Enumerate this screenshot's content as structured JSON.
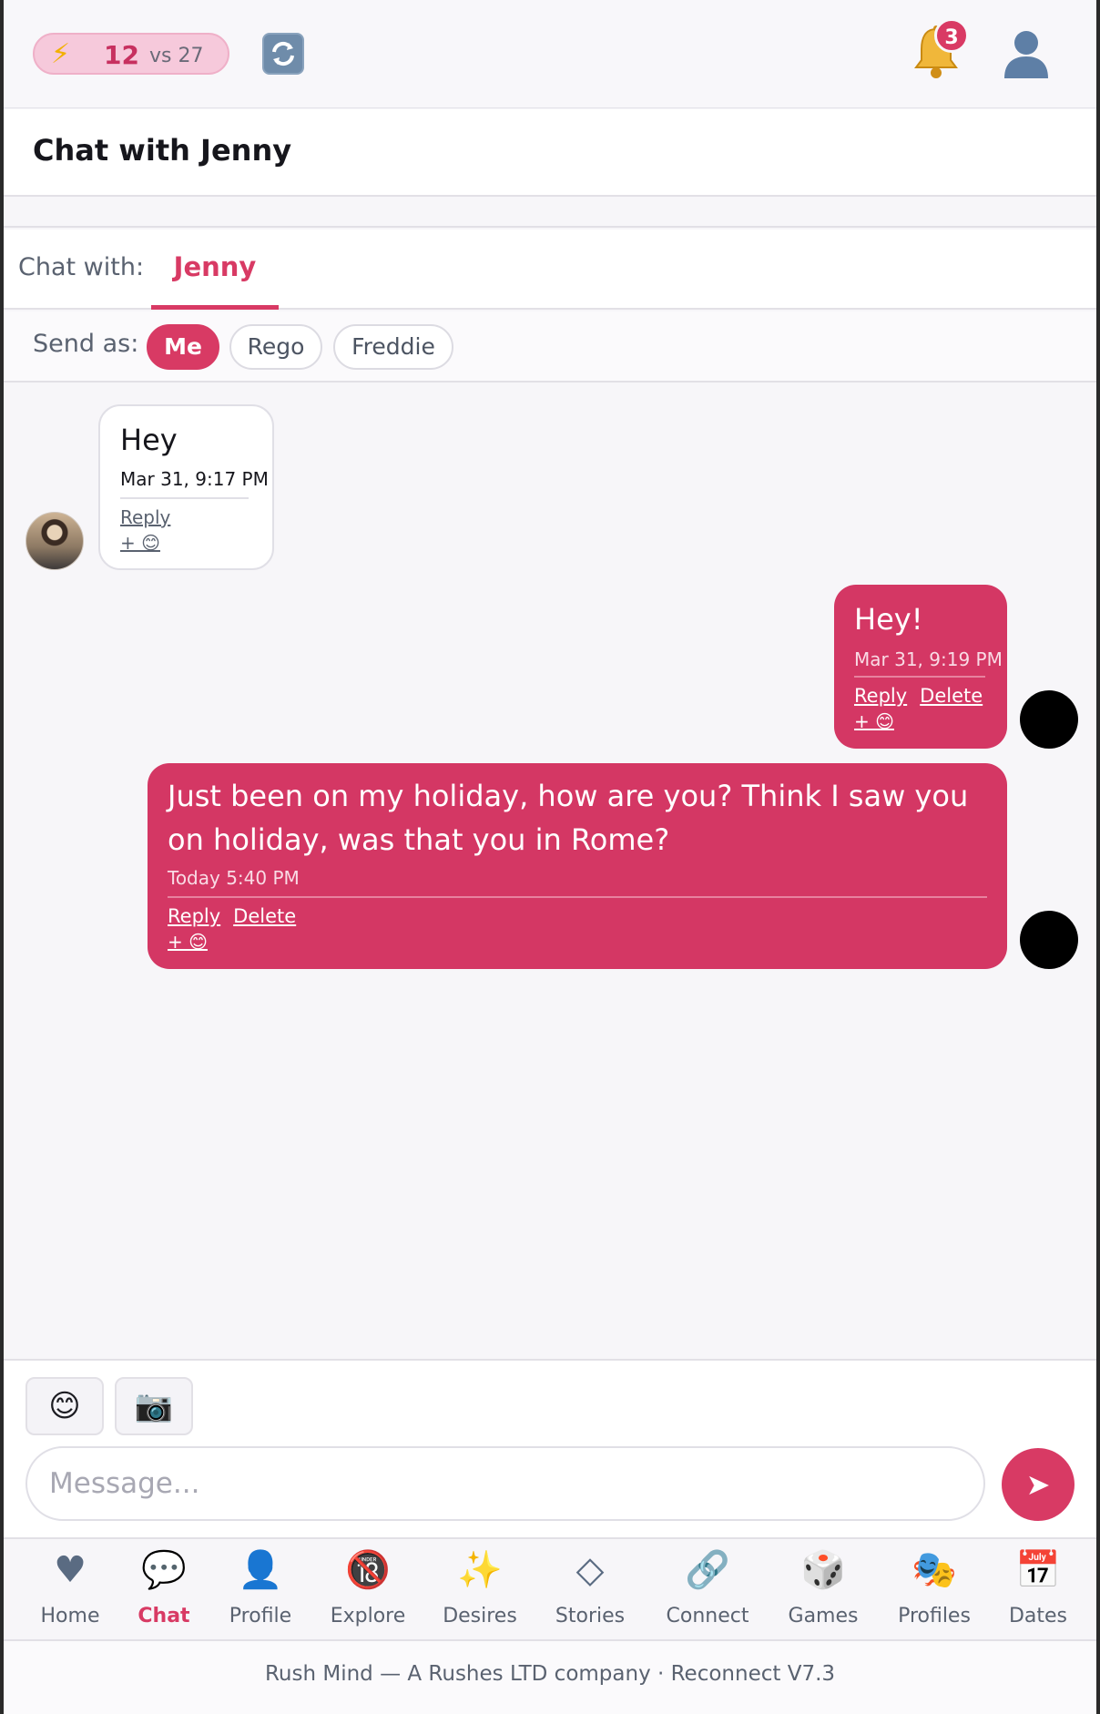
{
  "topbar": {
    "energy_value": "12",
    "energy_vs": "vs 27",
    "notification_count": "3"
  },
  "header": {
    "title": "Chat with Jenny"
  },
  "chat_with": {
    "label": "Chat with:",
    "active_tab": "Jenny"
  },
  "send_as": {
    "label": "Send as:",
    "options": [
      "Me",
      "Rego",
      "Freddie"
    ],
    "selected": "Me"
  },
  "messages": [
    {
      "direction": "in",
      "text": "Hey",
      "time": "Mar 31, 9:17 PM",
      "actions": [
        "Reply"
      ],
      "react": "+ 😊"
    },
    {
      "direction": "out",
      "text": "Hey!",
      "time": "Mar 31, 9:19 PM",
      "actions": [
        "Reply",
        "Delete"
      ],
      "react": "+ 😊"
    },
    {
      "direction": "out",
      "text": "Just been on my holiday, how are you? Think I saw you on holiday, was that you in Rome?",
      "time": "Today 5:40 PM",
      "actions": [
        "Reply",
        "Delete"
      ],
      "react": "+ 😊"
    }
  ],
  "composer": {
    "placeholder": "Message...",
    "value": ""
  },
  "nav": [
    {
      "label": "Home",
      "icon": "heart-icon"
    },
    {
      "label": "Chat",
      "icon": "speech-bubble-icon"
    },
    {
      "label": "Profile",
      "icon": "person-icon"
    },
    {
      "label": "Explore",
      "icon": "no-under-18-icon"
    },
    {
      "label": "Desires",
      "icon": "sparkles-icon"
    },
    {
      "label": "Stories",
      "icon": "diamond-icon"
    },
    {
      "label": "Connect",
      "icon": "link-icon"
    },
    {
      "label": "Games",
      "icon": "dice-icon"
    },
    {
      "label": "Profiles",
      "icon": "theater-masks-icon"
    },
    {
      "label": "Dates",
      "icon": "calendar-icon"
    }
  ],
  "nav_active": "Chat",
  "footer": {
    "text": "Rush Mind — A Rushes LTD company · Reconnect V7.3"
  },
  "colors": {
    "accent": "#d83a64",
    "bubble_out": "#d43764",
    "energy_pill": "#f6c9db"
  }
}
